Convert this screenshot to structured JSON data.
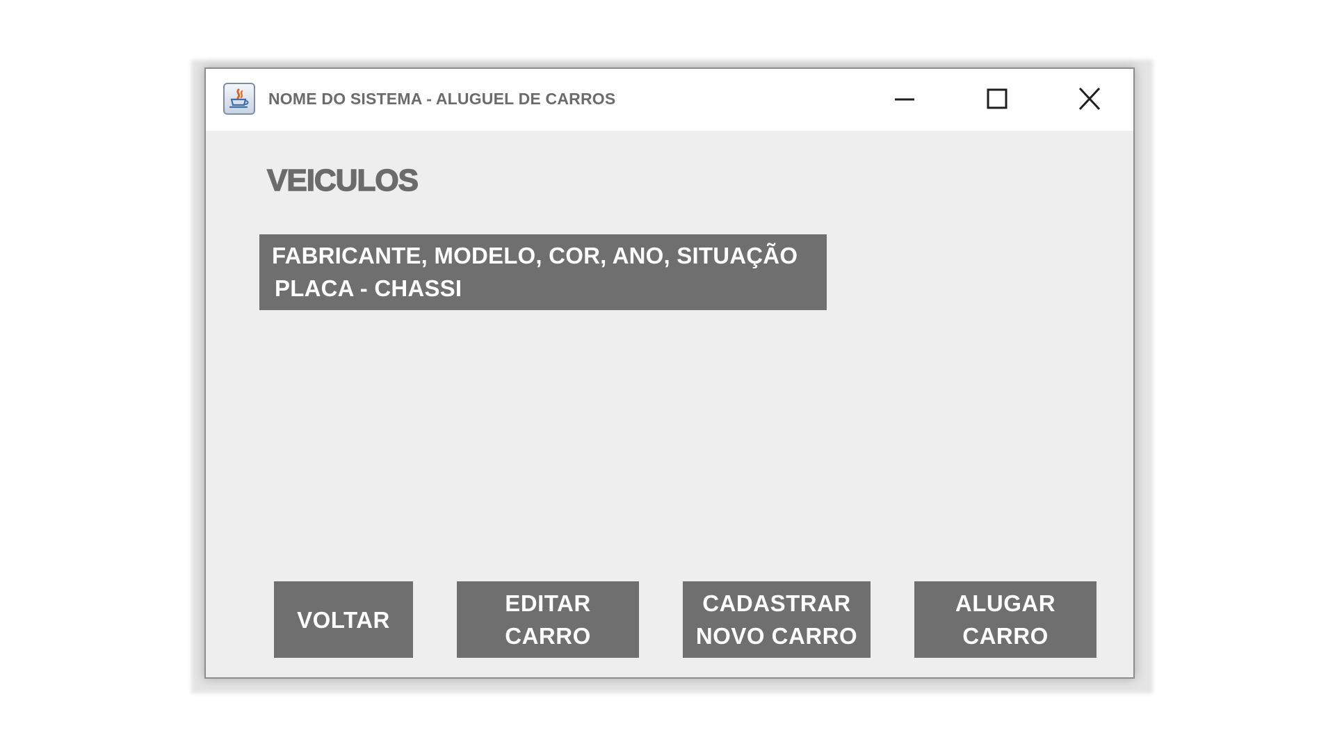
{
  "window": {
    "title": "NOME DO SISTEMA - ALUGUEL DE CARROS",
    "app_icon": "java-coffee-cup-icon",
    "controls": {
      "minimize_icon": "minimize-icon",
      "maximize_icon": "maximize-icon",
      "close_icon": "close-icon"
    }
  },
  "main": {
    "heading": "VEICULOS",
    "vehicle_list": {
      "items": [
        "FABRICANTE, MODELO, COR, ANO, SITUAÇÃO",
        "PLACA - CHASSI"
      ]
    }
  },
  "actions": {
    "back_label": "VOLTAR",
    "edit_label": "EDITAR\nCARRO",
    "register_label": "CADASTRAR\nNOVO CARRO",
    "rent_label": "ALUGAR\nCARRO"
  },
  "colors": {
    "window_bg": "#eeeeee",
    "titlebar_bg": "#ffffff",
    "button_bg": "#6f6f6f",
    "text_dark": "#6b6b6b",
    "text_light": "#ffffff"
  }
}
